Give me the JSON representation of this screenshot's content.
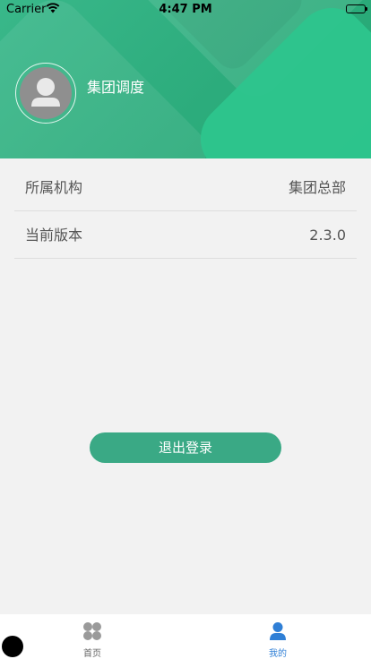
{
  "status_bar": {
    "carrier": "Carrier",
    "time": "4:47 PM"
  },
  "profile": {
    "name": "集团调度"
  },
  "info_rows": [
    {
      "label": "所属机构",
      "value": "集团总部"
    },
    {
      "label": "当前版本",
      "value": "2.3.0"
    }
  ],
  "logout_label": "退出登录",
  "tabs": [
    {
      "label": "首页",
      "icon": "grid-icon",
      "active": false
    },
    {
      "label": "我的",
      "icon": "person-icon",
      "active": true
    }
  ],
  "colors": {
    "brand": "#2fae7f",
    "tab_active": "#2f7fd6",
    "tab_inactive": "#9a9a9a"
  }
}
